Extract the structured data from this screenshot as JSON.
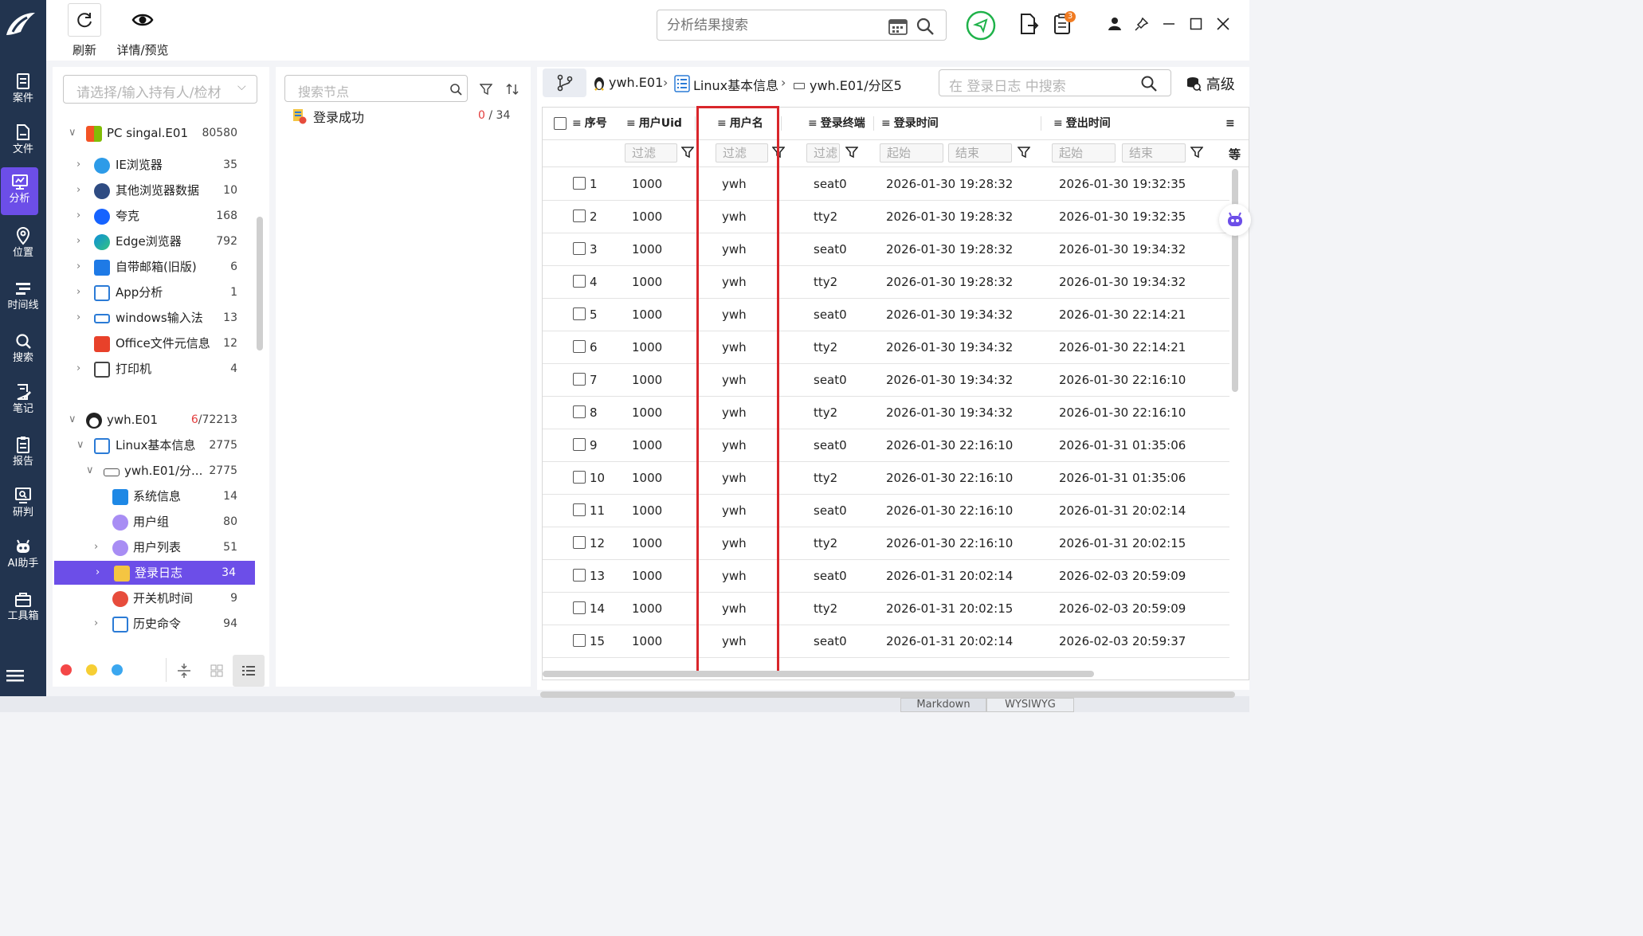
{
  "nav": {
    "items": [
      {
        "label": "案件",
        "icon": "case-icon"
      },
      {
        "label": "文件",
        "icon": "file-icon"
      },
      {
        "label": "分析",
        "icon": "analysis-icon"
      },
      {
        "label": "位置",
        "icon": "location-icon"
      },
      {
        "label": "时间线",
        "icon": "timeline-icon"
      },
      {
        "label": "搜索",
        "icon": "search-icon"
      },
      {
        "label": "笔记",
        "icon": "notes-icon"
      },
      {
        "label": "报告",
        "icon": "report-icon"
      },
      {
        "label": "研判",
        "icon": "judge-icon"
      },
      {
        "label": "AI助手",
        "icon": "ai-assistant-icon"
      },
      {
        "label": "工具箱",
        "icon": "toolbox-icon"
      }
    ],
    "active": "分析"
  },
  "toolbar": {
    "refresh_label": "刷新",
    "detail_label": "详情/预览"
  },
  "global_search": {
    "placeholder": "分析结果搜索",
    "badge_count": "3"
  },
  "owner_select": {
    "placeholder": "请选择/输入持有人/检材"
  },
  "tree": {
    "pc_root": {
      "label": "PC singal.E01",
      "count": "80580"
    },
    "pc_items": [
      {
        "label": "IE浏览器",
        "count": "35"
      },
      {
        "label": "其他浏览器数据",
        "count": "10"
      },
      {
        "label": "夸克",
        "count": "168"
      },
      {
        "label": "Edge浏览器",
        "count": "792"
      },
      {
        "label": "自带邮箱(旧版)",
        "count": "6"
      },
      {
        "label": "App分析",
        "count": "1"
      },
      {
        "label": "windows输入法",
        "count": "13"
      },
      {
        "label": "Office文件元信息",
        "count": "12"
      },
      {
        "label": "打印机",
        "count": "4"
      }
    ],
    "linux_root": {
      "label": "ywh.E01",
      "count_red": "6",
      "count_rest": "/72213"
    },
    "linux_info": {
      "label": "Linux基本信息",
      "count": "2775"
    },
    "partition": {
      "label": "ywh.E01/分...",
      "count": "2775"
    },
    "linux_items": [
      {
        "label": "系统信息",
        "count": "14"
      },
      {
        "label": "用户组",
        "count": "80"
      },
      {
        "label": "用户列表",
        "count": "51"
      },
      {
        "label": "登录日志",
        "count": "34"
      },
      {
        "label": "开关机时间",
        "count": "9"
      },
      {
        "label": "历史命令",
        "count": "94"
      }
    ]
  },
  "mid": {
    "search_placeholder": "搜索节点",
    "node_label": "登录成功",
    "count_red": "0",
    "count_rest": " / 34"
  },
  "breadcrumb": {
    "item1": "ywh.E01",
    "item2": "Linux基本信息",
    "item3": "ywh.E01/分区5"
  },
  "table_search": {
    "placeholder": "在 登录日志 中搜索",
    "advanced_label": "高级"
  },
  "table": {
    "headers": [
      "序号",
      "用户Uid",
      "用户名",
      "登录终端",
      "登录时间",
      "登出时间"
    ],
    "filter_placeholder": "过滤",
    "range_start": "起始",
    "range_end": "结束",
    "extra_header": "等",
    "rows": [
      [
        "1",
        "1000",
        "ywh",
        "seat0",
        "2026-01-30 19:28:32",
        "2026-01-30 19:32:35"
      ],
      [
        "2",
        "1000",
        "ywh",
        "tty2",
        "2026-01-30 19:28:32",
        "2026-01-30 19:32:35"
      ],
      [
        "3",
        "1000",
        "ywh",
        "seat0",
        "2026-01-30 19:28:32",
        "2026-01-30 19:34:32"
      ],
      [
        "4",
        "1000",
        "ywh",
        "tty2",
        "2026-01-30 19:28:32",
        "2026-01-30 19:34:32"
      ],
      [
        "5",
        "1000",
        "ywh",
        "seat0",
        "2026-01-30 19:34:32",
        "2026-01-30 22:14:21"
      ],
      [
        "6",
        "1000",
        "ywh",
        "tty2",
        "2026-01-30 19:34:32",
        "2026-01-30 22:14:21"
      ],
      [
        "7",
        "1000",
        "ywh",
        "seat0",
        "2026-01-30 19:34:32",
        "2026-01-30 22:16:10"
      ],
      [
        "8",
        "1000",
        "ywh",
        "tty2",
        "2026-01-30 19:34:32",
        "2026-01-30 22:16:10"
      ],
      [
        "9",
        "1000",
        "ywh",
        "seat0",
        "2026-01-30 22:16:10",
        "2026-01-31 01:35:06"
      ],
      [
        "10",
        "1000",
        "ywh",
        "tty2",
        "2026-01-30 22:16:10",
        "2026-01-31 01:35:06"
      ],
      [
        "11",
        "1000",
        "ywh",
        "seat0",
        "2026-01-30 22:16:10",
        "2026-01-31 20:02:14"
      ],
      [
        "12",
        "1000",
        "ywh",
        "tty2",
        "2026-01-30 22:16:10",
        "2026-01-31 20:02:15"
      ],
      [
        "13",
        "1000",
        "ywh",
        "seat0",
        "2026-01-31 20:02:14",
        "2026-02-03 20:59:09"
      ],
      [
        "14",
        "1000",
        "ywh",
        "tty2",
        "2026-01-31 20:02:15",
        "2026-02-03 20:59:09"
      ],
      [
        "15",
        "1000",
        "ywh",
        "seat0",
        "2026-01-31 20:02:14",
        "2026-02-03 20:59:37"
      ]
    ]
  },
  "footer": {
    "tab1": "Markdown",
    "tab2": "WYSIWYG"
  },
  "colors": {
    "accent": "#6c4ee8",
    "nav_bg": "#22344f",
    "highlight_red": "#d9262b",
    "green": "#1fb24a"
  }
}
